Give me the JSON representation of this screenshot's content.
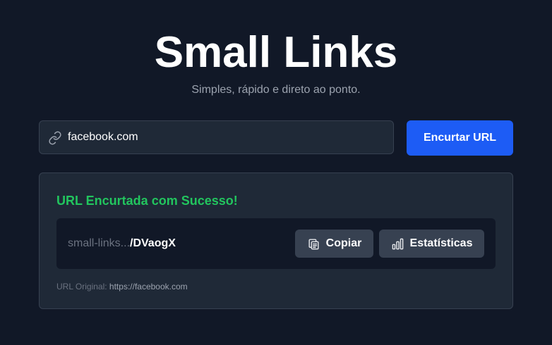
{
  "header": {
    "title": "Small Links",
    "subtitle": "Simples, rápido e direto ao ponto."
  },
  "form": {
    "url_value": "facebook.com",
    "link_icon": "link-icon",
    "submit_label": "Encurtar URL"
  },
  "result": {
    "heading": "URL Encurtada com Sucesso!",
    "short_url_domain": "small-links...",
    "short_url_code": "/DVaogX",
    "copy_label": "Copiar",
    "copy_icon": "clipboard-icon",
    "stats_label": "Estatísticas",
    "stats_icon": "bar-chart-icon",
    "original_label": "URL Original:",
    "original_url": "https://facebook.com"
  },
  "colors": {
    "background": "#111827",
    "card": "#1f2937",
    "primary": "#1d5cf5",
    "success": "#22c55e"
  }
}
